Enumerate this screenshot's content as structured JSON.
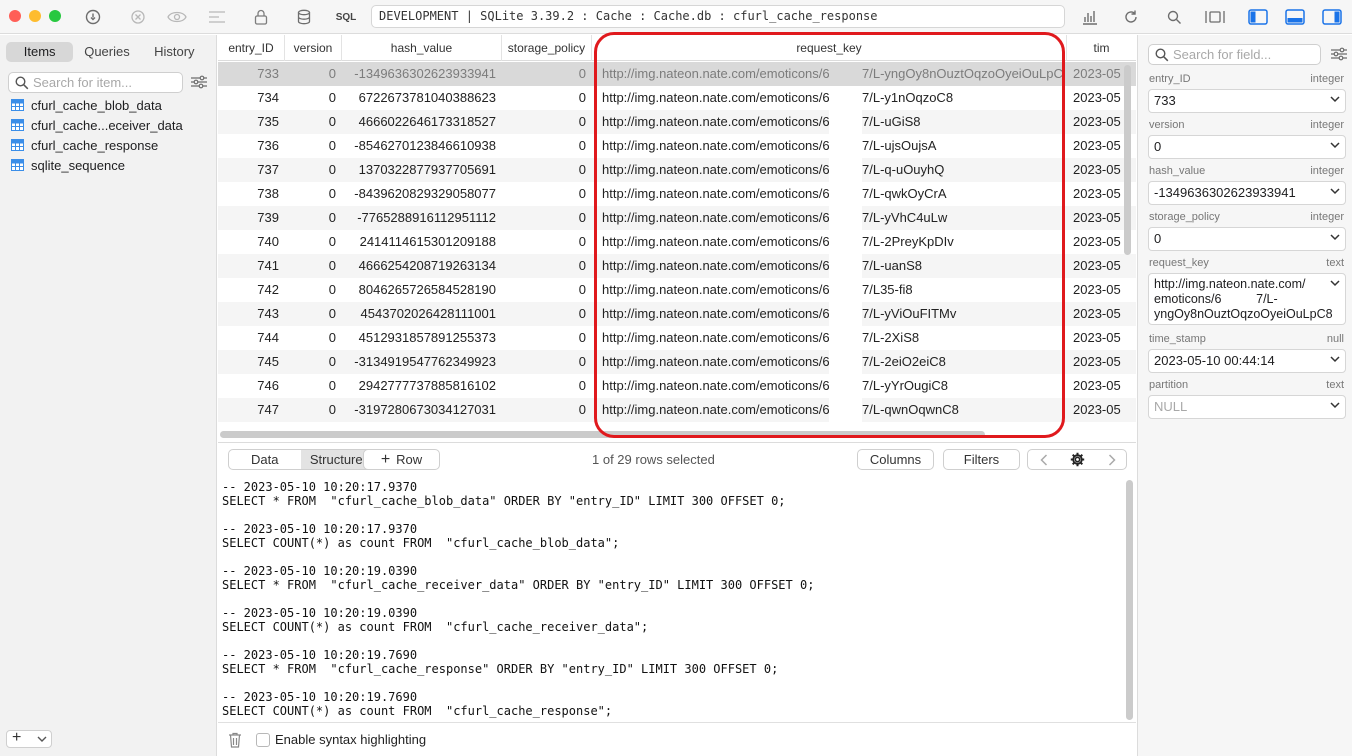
{
  "window": {
    "connection": "DEVELOPMENT | SQLite 3.39.2 : Cache : Cache.db : cfurl_cache_response",
    "sql_label": "SQL"
  },
  "colors": {
    "close": "#ff5f57",
    "minimize": "#febc2e",
    "zoom": "#28c840",
    "accent": "#1a73e8",
    "highlight": "#e0191d"
  },
  "sidebar": {
    "tabs": [
      "Items",
      "Queries",
      "History"
    ],
    "search_placeholder": "Search for item...",
    "tables": [
      "cfurl_cache_blob_data",
      "cfurl_cache...eceiver_data",
      "cfurl_cache_response",
      "sqlite_sequence"
    ]
  },
  "grid": {
    "columns": [
      "entry_ID",
      "version",
      "hash_value",
      "storage_policy",
      "request_key",
      "tim"
    ],
    "rows": [
      [
        "733",
        "0",
        "-1349636302623933941",
        "0",
        "http://img.nateon.nate.com/emoticons/6",
        "7/L-yngOy8nOuztOqzoOyeiOuLpC8",
        "2023-05"
      ],
      [
        "734",
        "0",
        "6722673781040388623",
        "0",
        "http://img.nateon.nate.com/emoticons/6",
        "7/L-y1nOqzoC8",
        "2023-05"
      ],
      [
        "735",
        "0",
        "4666022646173318527",
        "0",
        "http://img.nateon.nate.com/emoticons/6",
        "7/L-uGiS8",
        "2023-05"
      ],
      [
        "736",
        "0",
        "-8546270123846610938",
        "0",
        "http://img.nateon.nate.com/emoticons/6",
        "7/L-ujsOujsA",
        "2023-05"
      ],
      [
        "737",
        "0",
        "1370322877937705691",
        "0",
        "http://img.nateon.nate.com/emoticons/6",
        "7/L-q-uOuyhQ",
        "2023-05"
      ],
      [
        "738",
        "0",
        "-8439620829329058077",
        "0",
        "http://img.nateon.nate.com/emoticons/6",
        "7/L-qwkOyCrA",
        "2023-05"
      ],
      [
        "739",
        "0",
        "-7765288916112951112",
        "0",
        "http://img.nateon.nate.com/emoticons/6",
        "7/L-yVhC4uLw",
        "2023-05"
      ],
      [
        "740",
        "0",
        "2414114615301209188",
        "0",
        "http://img.nateon.nate.com/emoticons/6",
        "7/L-2PreyKpDIv",
        "2023-05"
      ],
      [
        "741",
        "0",
        "4666254208719263134",
        "0",
        "http://img.nateon.nate.com/emoticons/6",
        "7/L-uanS8",
        "2023-05"
      ],
      [
        "742",
        "0",
        "8046265726584528190",
        "0",
        "http://img.nateon.nate.com/emoticons/6",
        "7/L35-fi8",
        "2023-05"
      ],
      [
        "743",
        "0",
        "4543702026428111001",
        "0",
        "http://img.nateon.nate.com/emoticons/6",
        "7/L-yViOuFITMv",
        "2023-05"
      ],
      [
        "744",
        "0",
        "4512931857891255373",
        "0",
        "http://img.nateon.nate.com/emoticons/6",
        "7/L-2XiS8",
        "2023-05"
      ],
      [
        "745",
        "0",
        "-3134919547762349923",
        "0",
        "http://img.nateon.nate.com/emoticons/6",
        "7/L-2eiO2eiC8",
        "2023-05"
      ],
      [
        "746",
        "0",
        "2942777737885816102",
        "0",
        "http://img.nateon.nate.com/emoticons/6",
        "7/L-yYrOugiC8",
        "2023-05"
      ],
      [
        "747",
        "0",
        "-3197280673034127031",
        "0",
        "http://img.nateon.nate.com/emoticons/6",
        "7/L-qwnOqwnC8",
        "2023-05"
      ]
    ]
  },
  "toolbar": {
    "data_tab": "Data",
    "structure_tab": "Structure",
    "row_button": "Row",
    "status": "1 of 29 rows selected",
    "columns_button": "Columns",
    "filters_button": "Filters"
  },
  "log": [
    "-- 2023-05-10 10:20:17.9370",
    "SELECT * FROM  \"cfurl_cache_blob_data\" ORDER BY \"entry_ID\" LIMIT 300 OFFSET 0;",
    "",
    "-- 2023-05-10 10:20:17.9370",
    "SELECT COUNT(*) as count FROM  \"cfurl_cache_blob_data\";",
    "",
    "-- 2023-05-10 10:20:19.0390",
    "SELECT * FROM  \"cfurl_cache_receiver_data\" ORDER BY \"entry_ID\" LIMIT 300 OFFSET 0;",
    "",
    "-- 2023-05-10 10:20:19.0390",
    "SELECT COUNT(*) as count FROM  \"cfurl_cache_receiver_data\";",
    "",
    "-- 2023-05-10 10:20:19.7690",
    "SELECT * FROM  \"cfurl_cache_response\" ORDER BY \"entry_ID\" LIMIT 300 OFFSET 0;",
    "",
    "-- 2023-05-10 10:20:19.7690",
    "SELECT COUNT(*) as count FROM  \"cfurl_cache_response\";"
  ],
  "bottom": {
    "syntax_label": "Enable syntax highlighting"
  },
  "inspector": {
    "search_placeholder": "Search for field...",
    "fields": [
      {
        "name": "entry_ID",
        "type": "integer",
        "value": "733"
      },
      {
        "name": "version",
        "type": "integer",
        "value": "0"
      },
      {
        "name": "hash_value",
        "type": "integer",
        "value": "-1349636302623933941"
      },
      {
        "name": "storage_policy",
        "type": "integer",
        "value": "0"
      },
      {
        "name": "request_key",
        "type": "text",
        "value": "http://img.nateon.nate.com/\nemoticons/6          7/L-\nyngOy8nOuztOqzoOyeiOuLpC8"
      },
      {
        "name": "time_stamp",
        "type": "null",
        "value": "2023-05-10 00:44:14"
      },
      {
        "name": "partition",
        "type": "text",
        "value": "NULL"
      }
    ]
  }
}
